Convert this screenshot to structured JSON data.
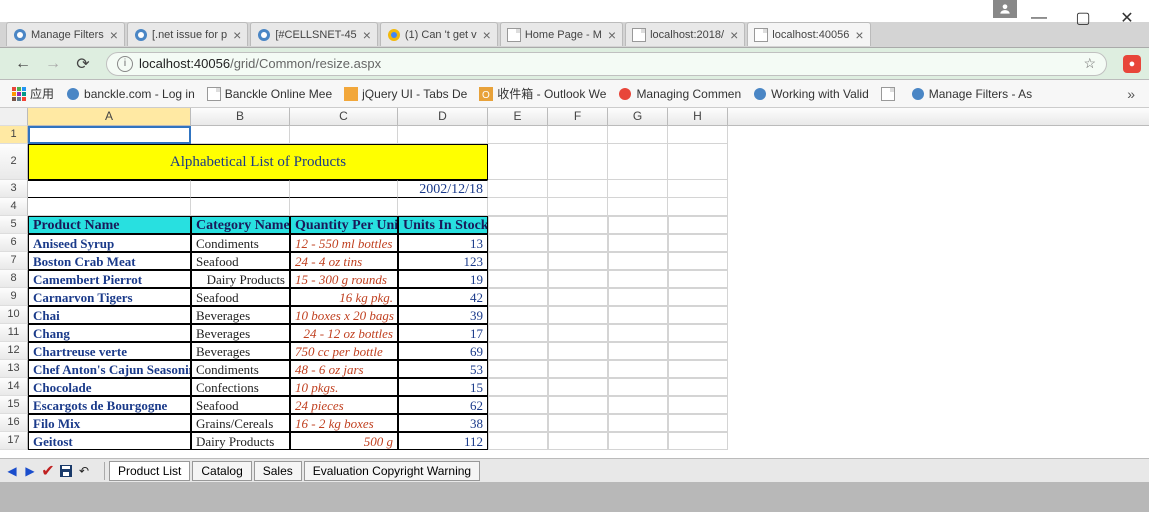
{
  "window": {
    "user_badge": true
  },
  "tabs": [
    {
      "icon": "aspose",
      "title": "Manage Filters"
    },
    {
      "icon": "aspose",
      "title": "[.net issue for p"
    },
    {
      "icon": "aspose",
      "title": "[#CELLSNET-45"
    },
    {
      "icon": "chrome",
      "title": "(1) Can 't get v"
    },
    {
      "icon": "file",
      "title": "Home Page - M"
    },
    {
      "icon": "file",
      "title": "localhost:2018/"
    },
    {
      "icon": "file",
      "title": "localhost:40056",
      "active": true
    }
  ],
  "address": {
    "host": "localhost",
    "port": ":40056",
    "path": "/grid/Common/resize.aspx"
  },
  "bookmarks": {
    "apps_label": "应用",
    "items": [
      {
        "icon": "aspose",
        "label": "banckle.com - Log in"
      },
      {
        "icon": "file",
        "label": "Banckle Online Mee"
      },
      {
        "icon": "jquery",
        "label": "jQuery UI - Tabs De"
      },
      {
        "icon": "outlook",
        "label": "收件箱 - Outlook We"
      },
      {
        "icon": "disqus",
        "label": "Managing Commen"
      },
      {
        "icon": "aspose",
        "label": "Working with Valid"
      },
      {
        "icon": "file",
        "label": ""
      },
      {
        "icon": "aspose",
        "label": "Manage Filters - As"
      }
    ]
  },
  "sheet": {
    "columns": [
      "A",
      "B",
      "C",
      "D",
      "E",
      "F",
      "G",
      "H"
    ],
    "title": "Alphabetical List of Products",
    "date": "2002/12/18",
    "headers": [
      "Product Name",
      "Category Name",
      "Quantity Per Uni",
      "Units In Stock"
    ],
    "rows": [
      {
        "a": "Aniseed Syrup",
        "b": "Condiments",
        "c": "12 - 550 ml bottles",
        "d": "13"
      },
      {
        "a": "Boston Crab Meat",
        "b": "Seafood",
        "c": "24 - 4 oz tins",
        "d": "123"
      },
      {
        "a": "Camembert Pierrot",
        "b": "Dairy Products",
        "b_right": true,
        "c": "15 - 300 g rounds",
        "d": "19"
      },
      {
        "a": "Carnarvon Tigers",
        "b": "Seafood",
        "c": "16 kg pkg.",
        "c_right": true,
        "d": "42"
      },
      {
        "a": "Chai",
        "b": "Beverages",
        "c": "10 boxes x 20 bags",
        "d": "39"
      },
      {
        "a": "Chang",
        "b": "Beverages",
        "c": "24 - 12 oz bottles",
        "c_right": true,
        "d": "17"
      },
      {
        "a": "Chartreuse verte",
        "b": "Beverages",
        "c": "750 cc per bottle",
        "d": "69"
      },
      {
        "a": "Chef Anton's Cajun Seasoning",
        "b": "Condiments",
        "c": "48 - 6 oz jars",
        "d": "53"
      },
      {
        "a": "Chocolade",
        "b": "Confections",
        "c": "10 pkgs.",
        "d": "15"
      },
      {
        "a": "Escargots de Bourgogne",
        "b": "Seafood",
        "c": "24 pieces",
        "d": "62"
      },
      {
        "a": "Filo Mix",
        "b": "Grains/Cereals",
        "c": "16 - 2 kg boxes",
        "d": "38"
      },
      {
        "a": "Geitost",
        "b": "Dairy Products",
        "c": "500 g",
        "c_right": true,
        "d": "112"
      }
    ],
    "tabs": [
      "Product List",
      "Catalog",
      "Sales",
      "Evaluation Copyright Warning"
    ]
  }
}
